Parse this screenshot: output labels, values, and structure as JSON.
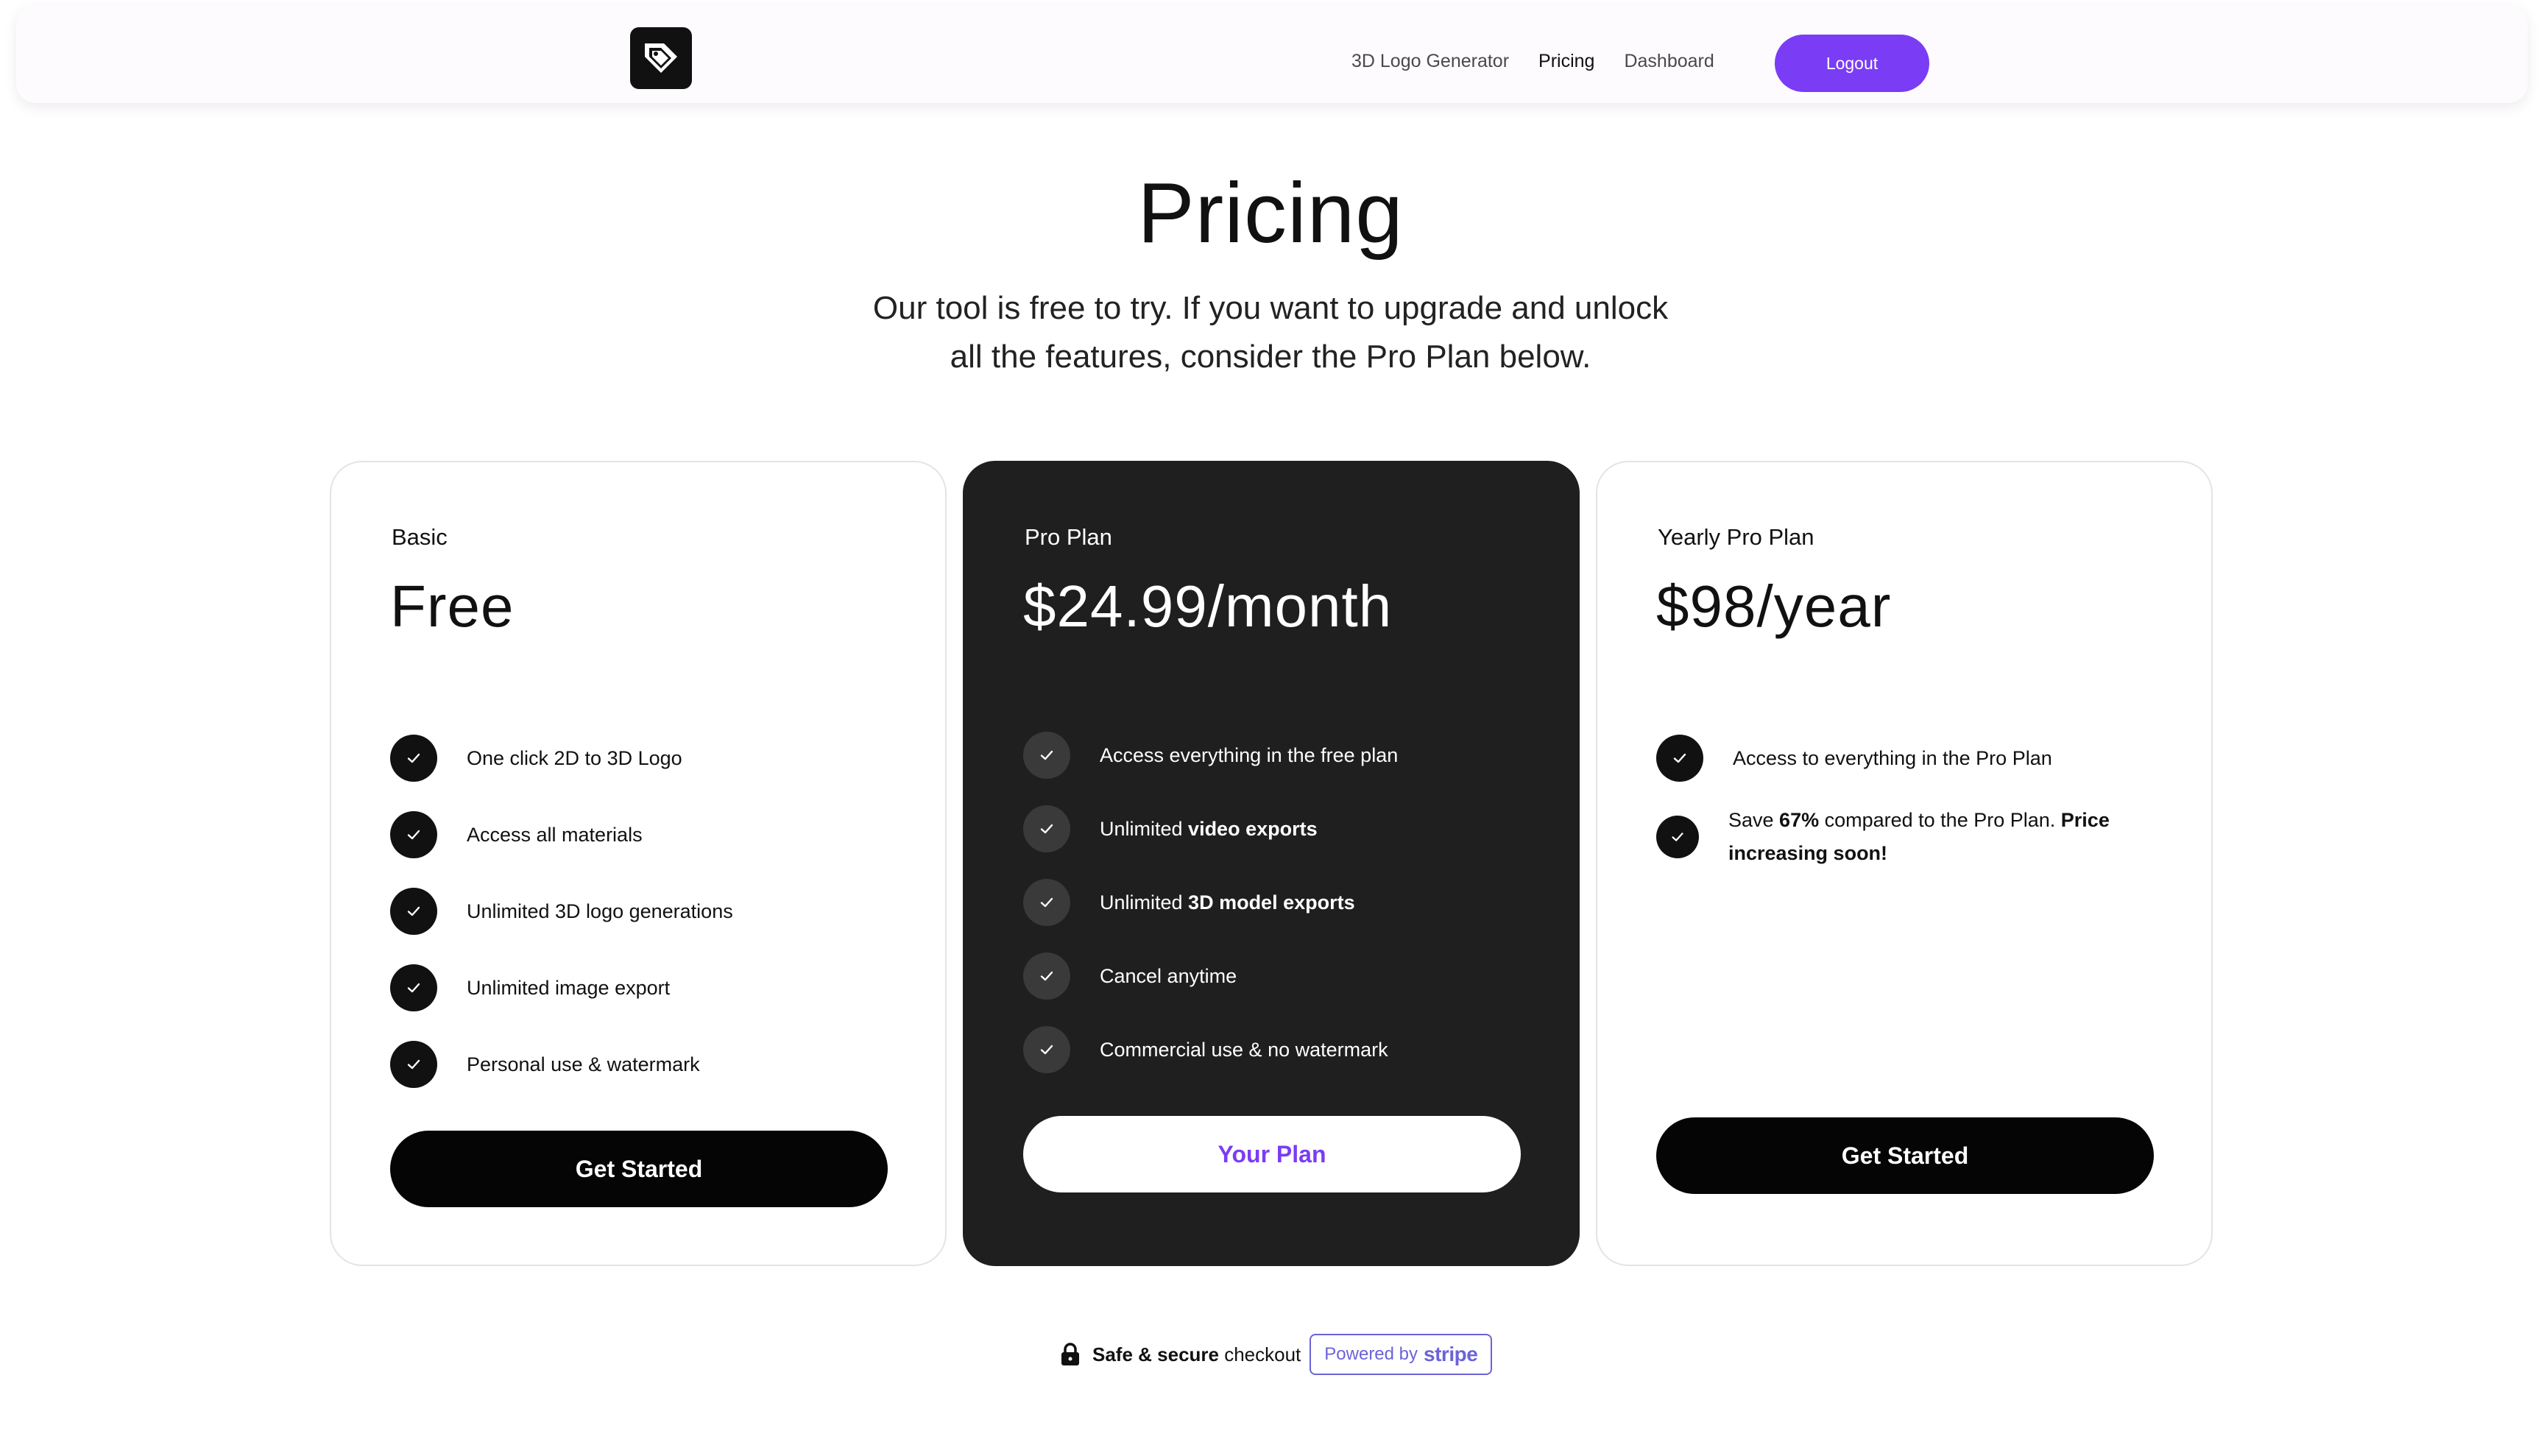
{
  "nav": {
    "logo_icon": "tag-logo-icon",
    "links": [
      "3D Logo Generator",
      "Pricing",
      "Dashboard"
    ],
    "active_link": "Pricing",
    "logout_label": "Logout",
    "accent": "#7a3cf5"
  },
  "header": {
    "title": "Pricing",
    "subtitle_line1": "Our tool is free to try. If you want to upgrade and unlock",
    "subtitle_line2": "all the features, consider the Pro Plan below."
  },
  "plans": [
    {
      "name": "Basic",
      "price": "Free",
      "features": [
        {
          "pre": "One click 2D to 3D Logo",
          "bold": "",
          "post": ""
        },
        {
          "pre": "Access all materials",
          "bold": "",
          "post": ""
        },
        {
          "pre": "Unlimited 3D logo generations",
          "bold": "",
          "post": ""
        },
        {
          "pre": "Unlimited image export",
          "bold": "",
          "post": ""
        },
        {
          "pre": "Personal use & watermark",
          "bold": "",
          "post": ""
        }
      ],
      "cta": "Get Started"
    },
    {
      "name": "Pro Plan",
      "price": "$24.99/month",
      "features": [
        {
          "pre": "Access everything in the free plan",
          "bold": "",
          "post": ""
        },
        {
          "pre": "Unlimited ",
          "bold": "video exports",
          "post": ""
        },
        {
          "pre": "Unlimited ",
          "bold": "3D model exports",
          "post": ""
        },
        {
          "pre": "Cancel anytime",
          "bold": "",
          "post": ""
        },
        {
          "pre": "Commercial use & no watermark",
          "bold": "",
          "post": ""
        }
      ],
      "cta": "Your Plan"
    },
    {
      "name": "Yearly Pro Plan",
      "price": "$98/year",
      "features": [
        {
          "pre": "Access to everything in the Pro Plan",
          "bold": "",
          "post": ""
        },
        {
          "pre": "Save ",
          "bold": "67%",
          "post": " compared to the Pro Plan. ",
          "bold2": "Price increasing soon!"
        }
      ],
      "cta": "Get Started"
    }
  ],
  "footer": {
    "secure_bold": "Safe & secure",
    "secure_rest": " checkout",
    "powered_by": "Powered by",
    "stripe": "stripe",
    "lock_icon": "lock-icon"
  }
}
